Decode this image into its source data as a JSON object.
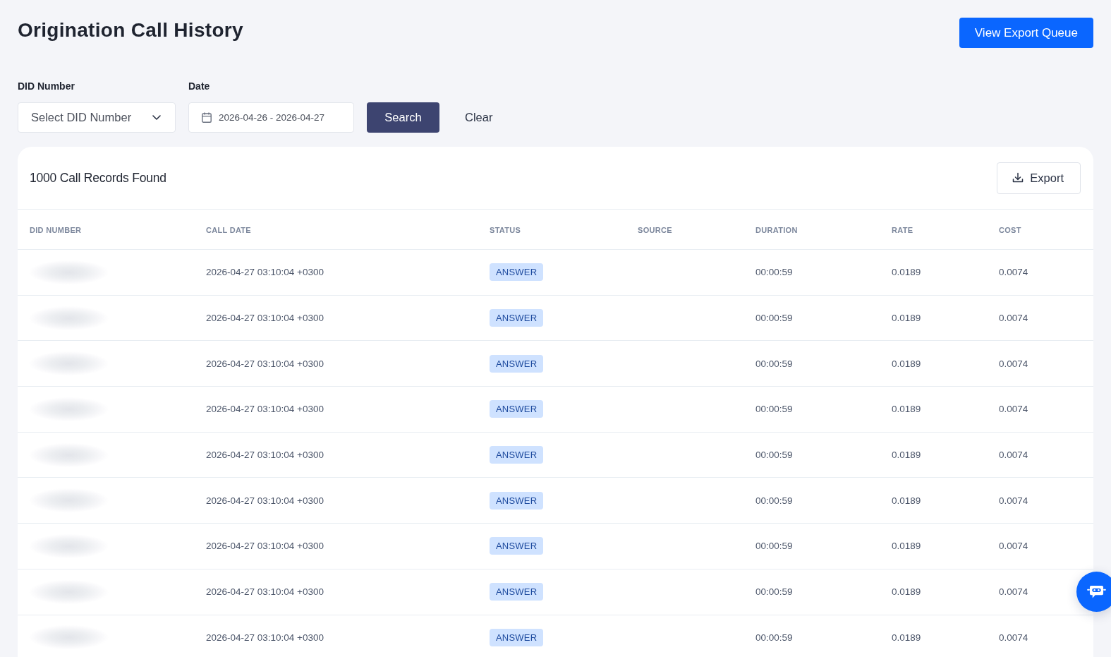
{
  "page": {
    "title": "Origination Call History",
    "export_queue_button": "View Export Queue"
  },
  "filters": {
    "did_number": {
      "label": "DID Number",
      "placeholder": "Select DID Number"
    },
    "date": {
      "label": "Date",
      "value": "2026-04-26 - 2026-04-27"
    },
    "search_button": "Search",
    "clear_button": "Clear"
  },
  "results": {
    "count_text": "1000 Call Records Found",
    "export_button": "Export",
    "table": {
      "columns": [
        "DID NUMBER",
        "CALL DATE",
        "STATUS",
        "SOURCE",
        "DURATION",
        "RATE",
        "COST"
      ],
      "rows": [
        {
          "did_redacted": true,
          "call_date": "2026-04-27 03:10:04 +0300",
          "status": "ANSWER",
          "duration": "00:00:59",
          "rate": "0.0189",
          "cost": "0.0074"
        },
        {
          "did_redacted": true,
          "call_date": "2026-04-27 03:10:04 +0300",
          "status": "ANSWER",
          "duration": "00:00:59",
          "rate": "0.0189",
          "cost": "0.0074"
        },
        {
          "did_redacted": true,
          "call_date": "2026-04-27 03:10:04 +0300",
          "status": "ANSWER",
          "duration": "00:00:59",
          "rate": "0.0189",
          "cost": "0.0074"
        },
        {
          "did_redacted": true,
          "call_date": "2026-04-27 03:10:04 +0300",
          "status": "ANSWER",
          "duration": "00:00:59",
          "rate": "0.0189",
          "cost": "0.0074"
        },
        {
          "did_redacted": true,
          "call_date": "2026-04-27 03:10:04 +0300",
          "status": "ANSWER",
          "duration": "00:00:59",
          "rate": "0.0189",
          "cost": "0.0074"
        },
        {
          "did_redacted": true,
          "call_date": "2026-04-27 03:10:04 +0300",
          "status": "ANSWER",
          "duration": "00:00:59",
          "rate": "0.0189",
          "cost": "0.0074"
        },
        {
          "did_redacted": true,
          "call_date": "2026-04-27 03:10:04 +0300",
          "status": "ANSWER",
          "duration": "00:00:59",
          "rate": "0.0189",
          "cost": "0.0074"
        },
        {
          "did_redacted": true,
          "call_date": "2026-04-27 03:10:04 +0300",
          "status": "ANSWER",
          "duration": "00:00:59",
          "rate": "0.0189",
          "cost": "0.0074"
        },
        {
          "did_redacted": true,
          "call_date": "2026-04-27 03:10:04 +0300",
          "status": "ANSWER",
          "duration": "00:00:59",
          "rate": "0.0189",
          "cost": "0.0074"
        }
      ]
    }
  }
}
